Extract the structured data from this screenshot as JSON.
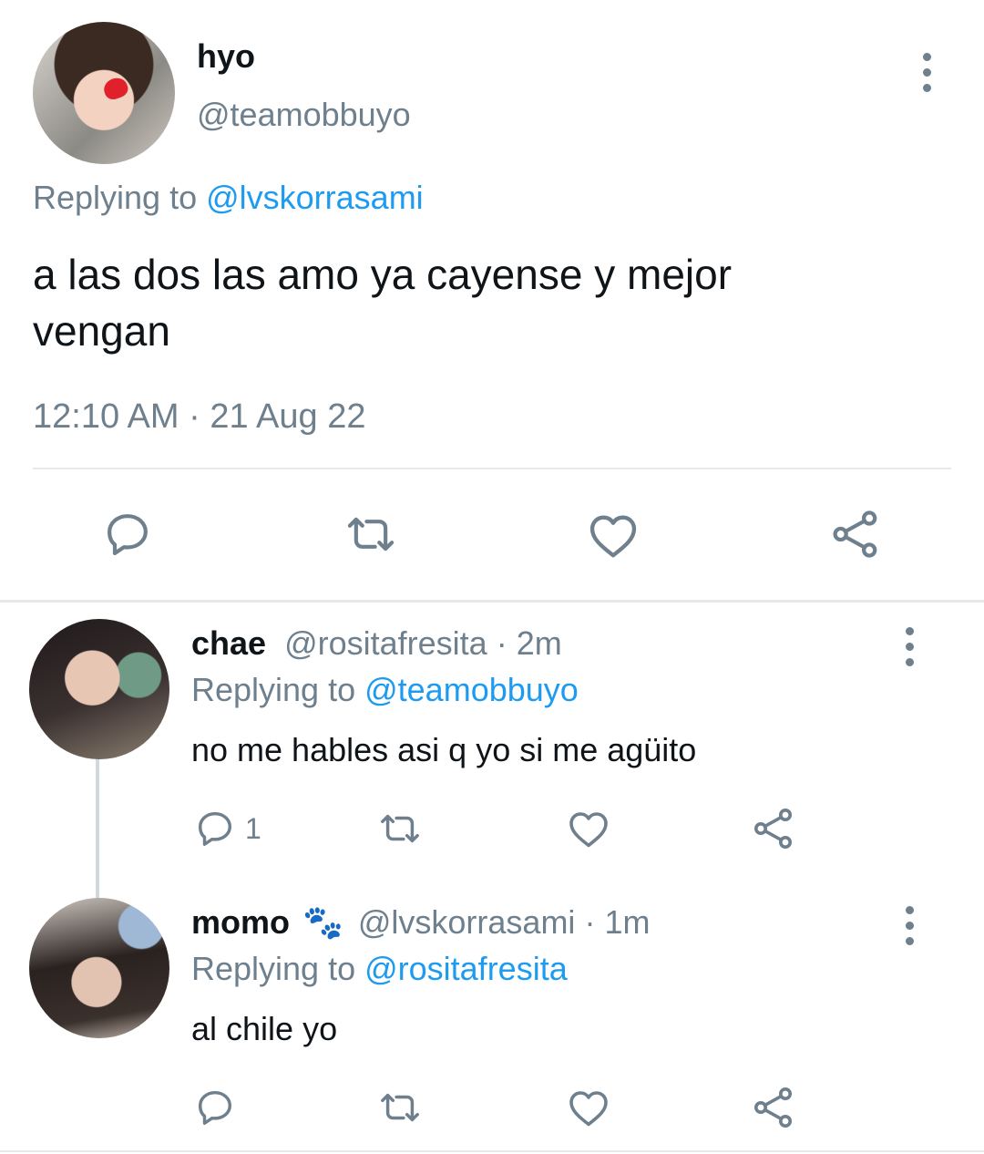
{
  "main_tweet": {
    "display_name": "hyo",
    "handle": "@teamobbuyo",
    "replying_prefix": "Replying to ",
    "replying_to": "@lvskorrasami",
    "text_line1": "a las dos las amo ya cayense y mejor",
    "text_line2": "vengan",
    "timestamp": "12:10 AM · 21 Aug 22"
  },
  "replies": [
    {
      "display_name": "chae",
      "handle": "@rositafresita",
      "separator": " · ",
      "time": "2m",
      "replying_prefix": "Replying to ",
      "replying_to": "@teamobbuyo",
      "text": "no me hables asi q yo si me agüito",
      "reply_count": "1"
    },
    {
      "display_name": "momo",
      "name_emoji": "🐾",
      "handle": "@lvskorrasami",
      "separator": " · ",
      "time": "1m",
      "replying_prefix": "Replying to ",
      "replying_to": "@rositafresita",
      "text": "al chile yo",
      "reply_count": ""
    }
  ],
  "icons": [
    "reply-icon",
    "retweet-icon",
    "like-icon",
    "share-icon",
    "more-options-icon"
  ],
  "colors": {
    "text": "#0f1419",
    "secondary": "#6e7f8d",
    "link": "#1d9bf0",
    "divider": "#e6e9eb"
  }
}
